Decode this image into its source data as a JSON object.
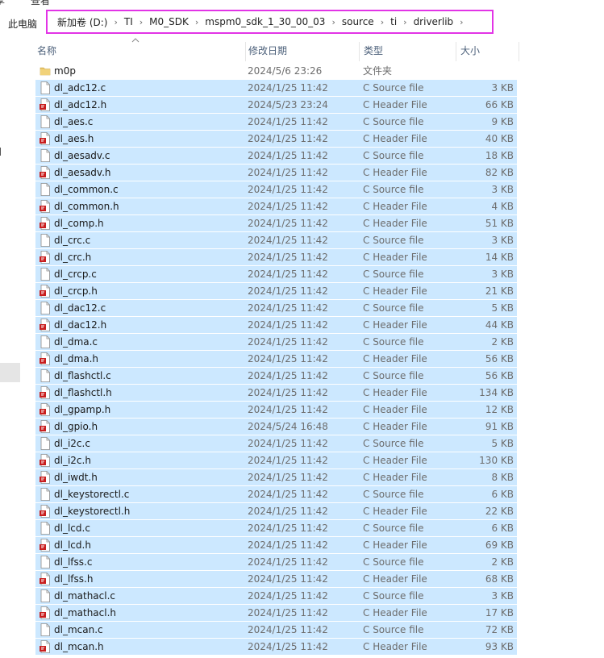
{
  "menu": {
    "left_fragment": "享",
    "view": "查看"
  },
  "address": {
    "this_pc": "此电脑",
    "crumbs": [
      "新加卷 (D:)",
      "TI",
      "M0_SDK",
      "mspm0_sdk_1_30_00_03",
      "source",
      "ti",
      "driverlib"
    ]
  },
  "columns": {
    "name": "名称",
    "date": "修改日期",
    "type": "类型",
    "size": "大小"
  },
  "colors": {
    "selection": "#cce8ff",
    "highlight_box": "#e234e6",
    "folder": "#e8c468",
    "header_file_badge": "#c81e1e"
  },
  "files": [
    {
      "name": "m0p",
      "date": "2024/5/6 23:26",
      "type": "文件夹",
      "size": "",
      "kind": "folder",
      "selected": false
    },
    {
      "name": "dl_adc12.c",
      "date": "2024/1/25 11:42",
      "type": "C Source file",
      "size": "3 KB",
      "kind": "c",
      "selected": true
    },
    {
      "name": "dl_adc12.h",
      "date": "2024/5/23 23:24",
      "type": "C Header File",
      "size": "66 KB",
      "kind": "h",
      "selected": true
    },
    {
      "name": "dl_aes.c",
      "date": "2024/1/25 11:42",
      "type": "C Source file",
      "size": "9 KB",
      "kind": "c",
      "selected": true
    },
    {
      "name": "dl_aes.h",
      "date": "2024/1/25 11:42",
      "type": "C Header File",
      "size": "40 KB",
      "kind": "h",
      "selected": true
    },
    {
      "name": "dl_aesadv.c",
      "date": "2024/1/25 11:42",
      "type": "C Source file",
      "size": "18 KB",
      "kind": "c",
      "selected": true
    },
    {
      "name": "dl_aesadv.h",
      "date": "2024/1/25 11:42",
      "type": "C Header File",
      "size": "82 KB",
      "kind": "h",
      "selected": true
    },
    {
      "name": "dl_common.c",
      "date": "2024/1/25 11:42",
      "type": "C Source file",
      "size": "3 KB",
      "kind": "c",
      "selected": true
    },
    {
      "name": "dl_common.h",
      "date": "2024/1/25 11:42",
      "type": "C Header File",
      "size": "4 KB",
      "kind": "h",
      "selected": true
    },
    {
      "name": "dl_comp.h",
      "date": "2024/1/25 11:42",
      "type": "C Header File",
      "size": "51 KB",
      "kind": "h",
      "selected": true
    },
    {
      "name": "dl_crc.c",
      "date": "2024/1/25 11:42",
      "type": "C Source file",
      "size": "3 KB",
      "kind": "c",
      "selected": true
    },
    {
      "name": "dl_crc.h",
      "date": "2024/1/25 11:42",
      "type": "C Header File",
      "size": "14 KB",
      "kind": "h",
      "selected": true
    },
    {
      "name": "dl_crcp.c",
      "date": "2024/1/25 11:42",
      "type": "C Source file",
      "size": "3 KB",
      "kind": "c",
      "selected": true
    },
    {
      "name": "dl_crcp.h",
      "date": "2024/1/25 11:42",
      "type": "C Header File",
      "size": "21 KB",
      "kind": "h",
      "selected": true
    },
    {
      "name": "dl_dac12.c",
      "date": "2024/1/25 11:42",
      "type": "C Source file",
      "size": "5 KB",
      "kind": "c",
      "selected": true
    },
    {
      "name": "dl_dac12.h",
      "date": "2024/1/25 11:42",
      "type": "C Header File",
      "size": "44 KB",
      "kind": "h",
      "selected": true
    },
    {
      "name": "dl_dma.c",
      "date": "2024/1/25 11:42",
      "type": "C Source file",
      "size": "2 KB",
      "kind": "c",
      "selected": true
    },
    {
      "name": "dl_dma.h",
      "date": "2024/1/25 11:42",
      "type": "C Header File",
      "size": "56 KB",
      "kind": "h",
      "selected": true
    },
    {
      "name": "dl_flashctl.c",
      "date": "2024/1/25 11:42",
      "type": "C Source file",
      "size": "56 KB",
      "kind": "c",
      "selected": true
    },
    {
      "name": "dl_flashctl.h",
      "date": "2024/1/25 11:42",
      "type": "C Header File",
      "size": "134 KB",
      "kind": "h",
      "selected": true
    },
    {
      "name": "dl_gpamp.h",
      "date": "2024/1/25 11:42",
      "type": "C Header File",
      "size": "12 KB",
      "kind": "h",
      "selected": true
    },
    {
      "name": "dl_gpio.h",
      "date": "2024/5/24 16:48",
      "type": "C Header File",
      "size": "91 KB",
      "kind": "h",
      "selected": true
    },
    {
      "name": "dl_i2c.c",
      "date": "2024/1/25 11:42",
      "type": "C Source file",
      "size": "5 KB",
      "kind": "c",
      "selected": true
    },
    {
      "name": "dl_i2c.h",
      "date": "2024/1/25 11:42",
      "type": "C Header File",
      "size": "130 KB",
      "kind": "h",
      "selected": true
    },
    {
      "name": "dl_iwdt.h",
      "date": "2024/1/25 11:42",
      "type": "C Header File",
      "size": "8 KB",
      "kind": "h",
      "selected": true
    },
    {
      "name": "dl_keystorectl.c",
      "date": "2024/1/25 11:42",
      "type": "C Source file",
      "size": "6 KB",
      "kind": "c",
      "selected": true
    },
    {
      "name": "dl_keystorectl.h",
      "date": "2024/1/25 11:42",
      "type": "C Header File",
      "size": "22 KB",
      "kind": "h",
      "selected": true
    },
    {
      "name": "dl_lcd.c",
      "date": "2024/1/25 11:42",
      "type": "C Source file",
      "size": "6 KB",
      "kind": "c",
      "selected": true
    },
    {
      "name": "dl_lcd.h",
      "date": "2024/1/25 11:42",
      "type": "C Header File",
      "size": "69 KB",
      "kind": "h",
      "selected": true
    },
    {
      "name": "dl_lfss.c",
      "date": "2024/1/25 11:42",
      "type": "C Source file",
      "size": "2 KB",
      "kind": "c",
      "selected": true
    },
    {
      "name": "dl_lfss.h",
      "date": "2024/1/25 11:42",
      "type": "C Header File",
      "size": "68 KB",
      "kind": "h",
      "selected": true
    },
    {
      "name": "dl_mathacl.c",
      "date": "2024/1/25 11:42",
      "type": "C Source file",
      "size": "3 KB",
      "kind": "c",
      "selected": true
    },
    {
      "name": "dl_mathacl.h",
      "date": "2024/1/25 11:42",
      "type": "C Header File",
      "size": "17 KB",
      "kind": "h",
      "selected": true
    },
    {
      "name": "dl_mcan.c",
      "date": "2024/1/25 11:42",
      "type": "C Source file",
      "size": "72 KB",
      "kind": "c",
      "selected": true
    },
    {
      "name": "dl_mcan.h",
      "date": "2024/1/25 11:42",
      "type": "C Header File",
      "size": "93 KB",
      "kind": "h",
      "selected": true
    }
  ]
}
